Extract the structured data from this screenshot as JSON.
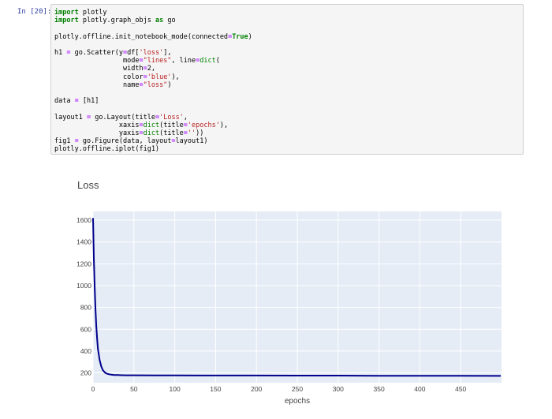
{
  "cell": {
    "prompt": "In [20]:",
    "lines": [
      [
        {
          "t": "import",
          "c": "kw"
        },
        {
          "t": " plotly"
        }
      ],
      [
        {
          "t": "import",
          "c": "kw"
        },
        {
          "t": " plotly.graph_objs "
        },
        {
          "t": "as",
          "c": "kw"
        },
        {
          "t": " go"
        }
      ],
      [],
      [
        {
          "t": "plotly.offline.init_notebook_mode(connected"
        },
        {
          "t": "=",
          "c": "op"
        },
        {
          "t": "True",
          "c": "kw"
        },
        {
          "t": ")"
        }
      ],
      [],
      [
        {
          "t": "h1 "
        },
        {
          "t": "=",
          "c": "op"
        },
        {
          "t": " go.Scatter(y"
        },
        {
          "t": "=",
          "c": "op"
        },
        {
          "t": "df["
        },
        {
          "t": "'loss'",
          "c": "str"
        },
        {
          "t": "],"
        }
      ],
      [
        {
          "t": "                 mode"
        },
        {
          "t": "=",
          "c": "op"
        },
        {
          "t": "\"lines\"",
          "c": "str"
        },
        {
          "t": ", line"
        },
        {
          "t": "=",
          "c": "op"
        },
        {
          "t": "dict",
          "c": "bi"
        },
        {
          "t": "("
        }
      ],
      [
        {
          "t": "                 width"
        },
        {
          "t": "=",
          "c": "op"
        },
        {
          "t": "2,"
        }
      ],
      [
        {
          "t": "                 color"
        },
        {
          "t": "=",
          "c": "op"
        },
        {
          "t": "'blue'",
          "c": "str"
        },
        {
          "t": "),"
        }
      ],
      [
        {
          "t": "                 name"
        },
        {
          "t": "=",
          "c": "op"
        },
        {
          "t": "\"loss\"",
          "c": "str"
        },
        {
          "t": ")"
        }
      ],
      [],
      [
        {
          "t": "data "
        },
        {
          "t": "=",
          "c": "op"
        },
        {
          "t": " [h1]"
        }
      ],
      [],
      [
        {
          "t": "layout1 "
        },
        {
          "t": "=",
          "c": "op"
        },
        {
          "t": " go.Layout(title"
        },
        {
          "t": "=",
          "c": "op"
        },
        {
          "t": "'Loss'",
          "c": "str"
        },
        {
          "t": ","
        }
      ],
      [
        {
          "t": "                xaxis"
        },
        {
          "t": "=",
          "c": "op"
        },
        {
          "t": "dict",
          "c": "bi"
        },
        {
          "t": "(title"
        },
        {
          "t": "=",
          "c": "op"
        },
        {
          "t": "'epochs'",
          "c": "str"
        },
        {
          "t": "),"
        }
      ],
      [
        {
          "t": "                yaxis"
        },
        {
          "t": "=",
          "c": "op"
        },
        {
          "t": "dict",
          "c": "bi"
        },
        {
          "t": "(title"
        },
        {
          "t": "=",
          "c": "op"
        },
        {
          "t": "''",
          "c": "str"
        },
        {
          "t": "))"
        }
      ],
      [
        {
          "t": "fig1 "
        },
        {
          "t": "=",
          "c": "op"
        },
        {
          "t": " go.Figure(data, layout"
        },
        {
          "t": "=",
          "c": "op"
        },
        {
          "t": "layout1)"
        }
      ],
      [
        {
          "t": "plotly.offline.iplot(fig1)"
        }
      ]
    ]
  },
  "chart_data": {
    "type": "line",
    "title": "Loss",
    "xlabel": "epochs",
    "ylabel": "",
    "xlim": [
      0,
      500
    ],
    "ylim": [
      110,
      1680
    ],
    "xticks": [
      0,
      50,
      100,
      150,
      200,
      250,
      300,
      350,
      400,
      450
    ],
    "yticks": [
      200,
      400,
      600,
      800,
      1000,
      1200,
      1400,
      1600
    ],
    "grid": true,
    "series": [
      {
        "color": "#00008b",
        "x": [
          0,
          1,
          2,
          3,
          4,
          5,
          6,
          8,
          10,
          12,
          15,
          18,
          22,
          26,
          30,
          35,
          40,
          50,
          75,
          100,
          150,
          200,
          250,
          300,
          350,
          400,
          450,
          499
        ],
        "y": [
          1620,
          1250,
          980,
          780,
          630,
          510,
          420,
          320,
          260,
          225,
          200,
          190,
          184,
          181,
          180,
          179,
          178,
          178,
          177,
          177,
          176,
          176,
          175,
          175,
          174,
          174,
          173,
          172
        ]
      }
    ]
  }
}
